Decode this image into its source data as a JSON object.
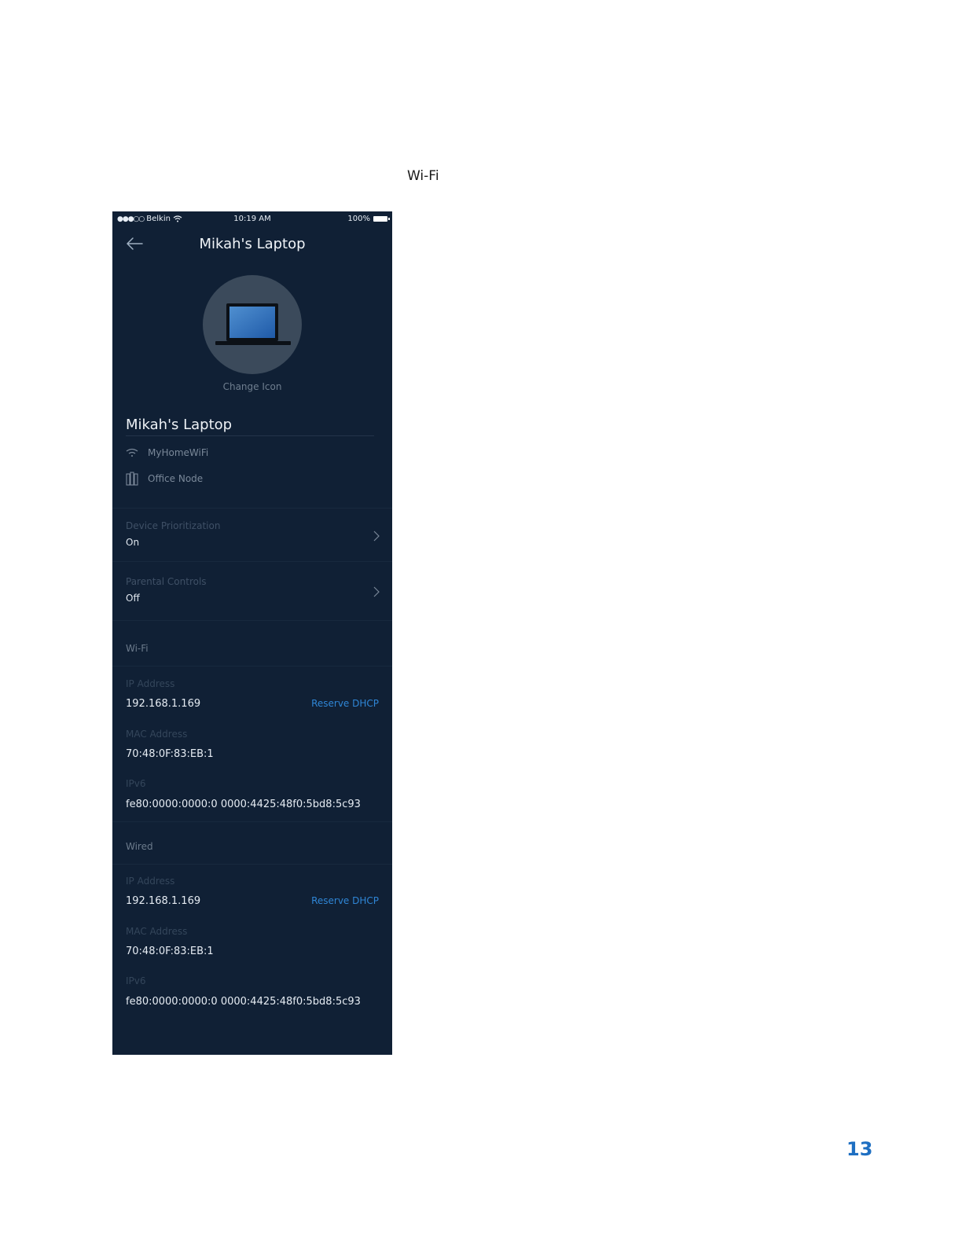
{
  "page": {
    "caption": "Wi-Fi",
    "page_number": "13"
  },
  "status_bar": {
    "signal": "●●●○○",
    "carrier": "Belkin",
    "time": "10:19 AM",
    "battery": "100%"
  },
  "header": {
    "title": "Mikah's Laptop"
  },
  "device": {
    "change_icon_label": "Change Icon",
    "name": "Mikah's Laptop",
    "network": "MyHomeWiFi",
    "node": "Office Node"
  },
  "settings": [
    {
      "label": "Device Prioritization",
      "value": "On"
    },
    {
      "label": "Parental Controls",
      "value": "Off"
    }
  ],
  "wifi_section": {
    "title": "Wi-Fi",
    "ip_label": "IP Address",
    "ip_value": "192.168.1.169",
    "reserve_label": "Reserve DHCP",
    "mac_label": "MAC Address",
    "mac_value": "70:48:0F:83:EB:1",
    "ipv6_label": "IPv6",
    "ipv6_value": "fe80:0000:0000:0 0000:4425:48f0:5bd8:5c93"
  },
  "wired_section": {
    "title": "Wired",
    "ip_label": "IP Address",
    "ip_value": "192.168.1.169",
    "reserve_label": "Reserve DHCP",
    "mac_label": "MAC Address",
    "mac_value": "70:48:0F:83:EB:1",
    "ipv6_label": "IPv6",
    "ipv6_value": "fe80:0000:0000:0 0000:4425:48f0:5bd8:5c93"
  },
  "icons": {
    "back": "arrow-left-icon",
    "wifi": "wifi-icon",
    "node": "node-icon",
    "laptop": "laptop-icon",
    "chevron": "chevron-right-icon"
  },
  "colors": {
    "screen_background": "#102035",
    "link_blue": "#2f86d6",
    "page_number_blue": "#1e6fc2"
  }
}
